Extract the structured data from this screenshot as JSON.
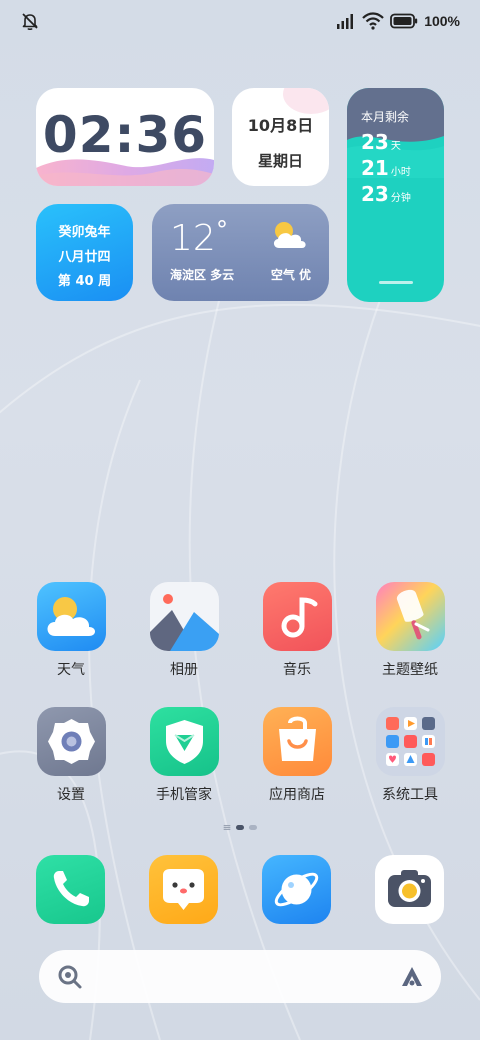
{
  "status_bar": {
    "battery_text": "100%",
    "icons": [
      "bell-off-icon",
      "signal-icon",
      "wifi-icon",
      "battery-icon"
    ]
  },
  "widgets": {
    "clock": {
      "time": "02:36"
    },
    "date": {
      "date": "10月8日",
      "weekday": "星期日"
    },
    "month_remaining": {
      "label": "本月剩余",
      "days": "23",
      "days_unit": "天",
      "hours": "21",
      "hours_unit": "小时",
      "minutes": "23",
      "minutes_unit": "分钟"
    },
    "lunar": {
      "year": "癸卯兔年",
      "day": "八月廿四",
      "week": "第 40 周"
    },
    "weather": {
      "temperature": "12",
      "degree_symbol": "°",
      "location": "海淀区 多云",
      "air_quality": "空气 优",
      "icon": "partly-cloudy-icon"
    }
  },
  "apps": [
    {
      "label": "天气",
      "icon": "weather-icon"
    },
    {
      "label": "相册",
      "icon": "gallery-icon"
    },
    {
      "label": "音乐",
      "icon": "music-icon"
    },
    {
      "label": "主题壁纸",
      "icon": "themes-icon"
    },
    {
      "label": "设置",
      "icon": "settings-icon"
    },
    {
      "label": "手机管家",
      "icon": "security-icon"
    },
    {
      "label": "应用商店",
      "icon": "app-store-icon"
    },
    {
      "label": "系统工具",
      "icon": "tools-folder-icon"
    }
  ],
  "page_indicator": {
    "pages": 2,
    "current": 1
  },
  "dock": [
    {
      "icon": "phone-icon"
    },
    {
      "icon": "messages-icon"
    },
    {
      "icon": "browser-icon"
    },
    {
      "icon": "camera-icon"
    }
  ],
  "search_bar": {
    "left_icon": "search-icon",
    "right_icon": "assistant-icon"
  }
}
